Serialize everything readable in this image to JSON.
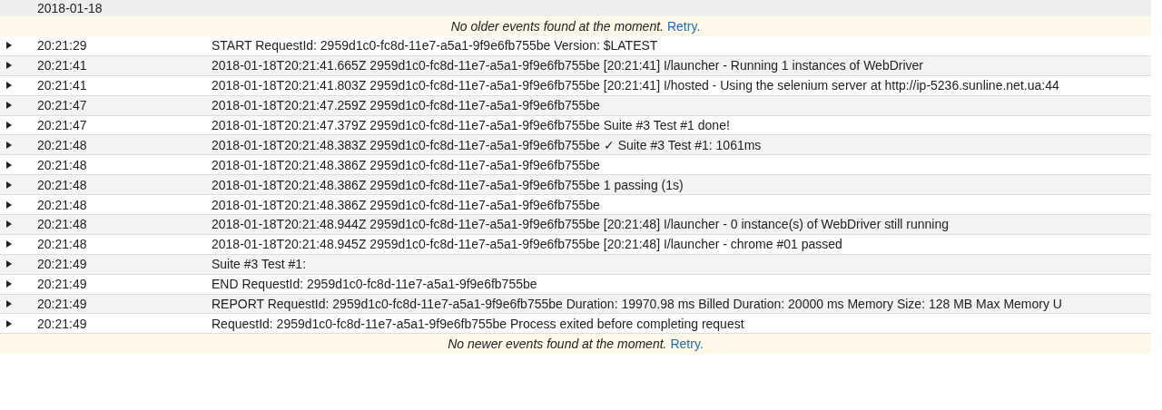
{
  "date_header": "2018-01-18",
  "older_notice": {
    "message": "No older events found at the moment.",
    "link": "Retry."
  },
  "events": [
    {
      "time": "20:21:29",
      "message": "START RequestId: 2959d1c0-fc8d-11e7-a5a1-9f9e6fb755be Version: $LATEST",
      "expanded": false
    },
    {
      "time": "20:21:41",
      "message": "2018-01-18T20:21:41.665Z 2959d1c0-fc8d-11e7-a5a1-9f9e6fb755be [20:21:41] I/launcher - Running 1 instances of WebDriver",
      "expanded": false
    },
    {
      "time": "20:21:41",
      "message": "2018-01-18T20:21:41.803Z 2959d1c0-fc8d-11e7-a5a1-9f9e6fb755be [20:21:41] I/hosted - Using the selenium server at http://ip-5236.sunline.net.ua:44",
      "expanded": false
    },
    {
      "time": "20:21:47",
      "message": "2018-01-18T20:21:47.259Z 2959d1c0-fc8d-11e7-a5a1-9f9e6fb755be",
      "expanded": false
    },
    {
      "time": "20:21:47",
      "message": "2018-01-18T20:21:47.379Z 2959d1c0-fc8d-11e7-a5a1-9f9e6fb755be Suite #3 Test #1 done!",
      "expanded": false
    },
    {
      "time": "20:21:48",
      "message": "2018-01-18T20:21:48.383Z 2959d1c0-fc8d-11e7-a5a1-9f9e6fb755be ✓ Suite #3 Test #1: 1061ms",
      "expanded": false
    },
    {
      "time": "20:21:48",
      "message": "2018-01-18T20:21:48.386Z 2959d1c0-fc8d-11e7-a5a1-9f9e6fb755be",
      "expanded": false
    },
    {
      "time": "20:21:48",
      "message": "2018-01-18T20:21:48.386Z 2959d1c0-fc8d-11e7-a5a1-9f9e6fb755be 1 passing (1s)",
      "expanded": false
    },
    {
      "time": "20:21:48",
      "message": "2018-01-18T20:21:48.386Z 2959d1c0-fc8d-11e7-a5a1-9f9e6fb755be",
      "expanded": false
    },
    {
      "time": "20:21:48",
      "message": "2018-01-18T20:21:48.944Z 2959d1c0-fc8d-11e7-a5a1-9f9e6fb755be [20:21:48] I/launcher - 0 instance(s) of WebDriver still running",
      "expanded": false
    },
    {
      "time": "20:21:48",
      "message": "2018-01-18T20:21:48.945Z 2959d1c0-fc8d-11e7-a5a1-9f9e6fb755be [20:21:48] I/launcher - chrome #01 passed",
      "expanded": false
    },
    {
      "time": "20:21:49",
      "message": "Suite #3 Test #1:",
      "expanded": false
    },
    {
      "time": "20:21:49",
      "message": "END RequestId: 2959d1c0-fc8d-11e7-a5a1-9f9e6fb755be",
      "expanded": false
    },
    {
      "time": "20:21:49",
      "message": "REPORT RequestId: 2959d1c0-fc8d-11e7-a5a1-9f9e6fb755be Duration: 19970.98 ms Billed Duration: 20000 ms Memory Size: 128 MB Max Memory U",
      "expanded": false
    },
    {
      "time": "20:21:49",
      "message": "RequestId: 2959d1c0-fc8d-11e7-a5a1-9f9e6fb755be Process exited before completing request",
      "expanded": false
    }
  ],
  "newer_notice": {
    "message": "No newer events found at the moment.",
    "link": "Retry."
  }
}
